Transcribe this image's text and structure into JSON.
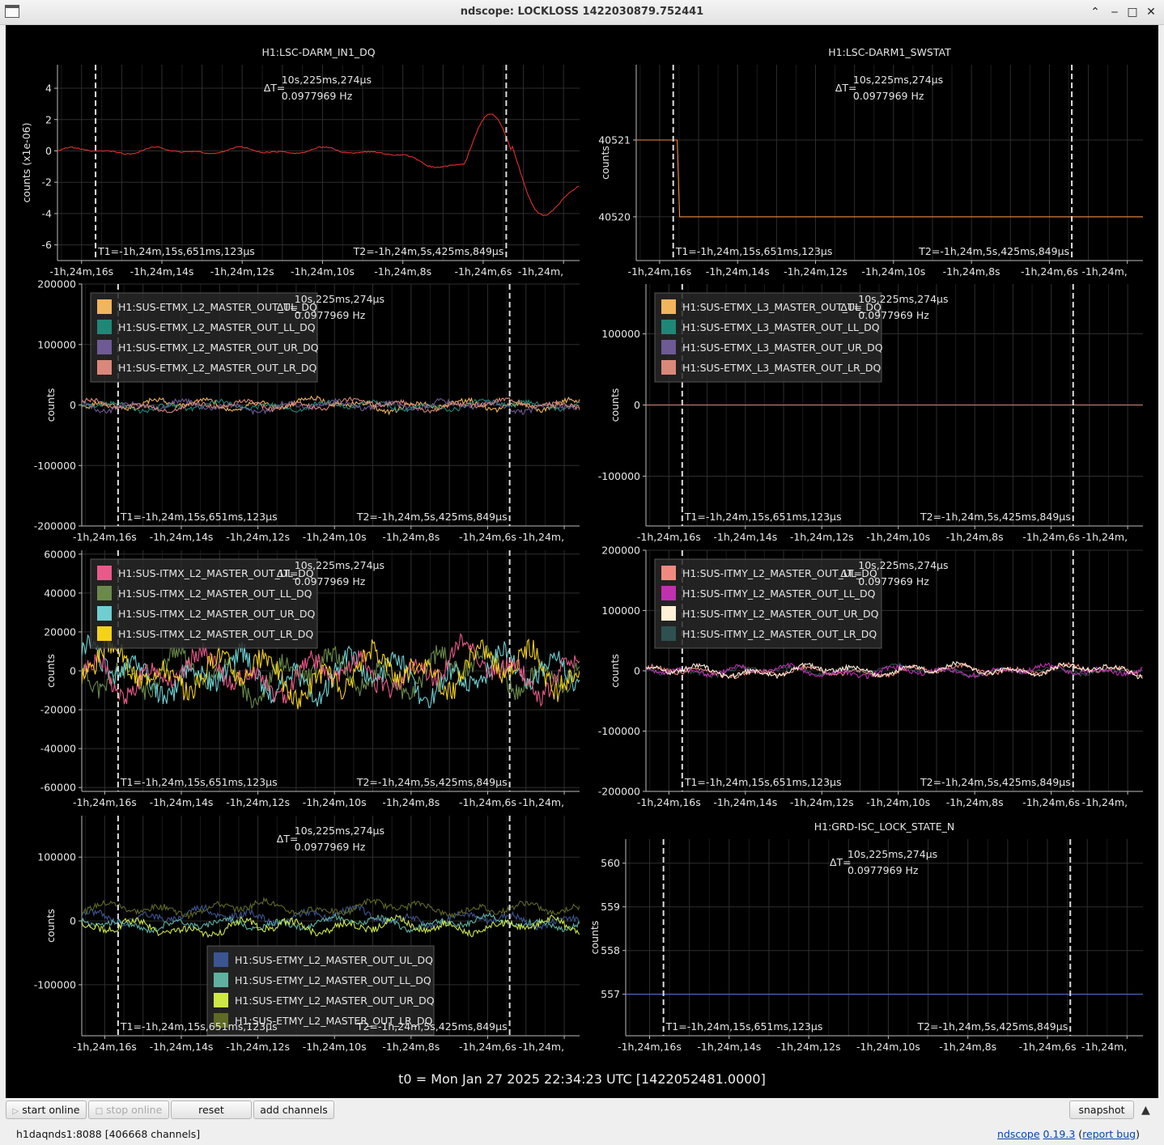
{
  "window": {
    "title": "ndscope: LOCKLOSS 1422030879.752441"
  },
  "cursor": {
    "delta_t": "10s,225ms,274µs",
    "freq": "0.0977969 Hz",
    "delta_label": "ΔT=",
    "t1": "T1=-1h,24m,15s,651ms,123µs",
    "t2": "T2=-1h,24m,5s,425ms,849µs"
  },
  "x_ticks": [
    "-1h,24m,16s",
    "-1h,24m,14s",
    "-1h,24m,12s",
    "-1h,24m,10s",
    "-1h,24m,8s",
    "-1h,24m,6s",
    "-1h,24m,"
  ],
  "x_tick_values": [
    -16,
    -14,
    -12,
    -10,
    -8,
    -6,
    -4
  ],
  "x_range": [
    -16.6,
    -3.6
  ],
  "cursor_x": [
    -15.651,
    -5.426
  ],
  "plots": [
    {
      "id": "p1",
      "title": "H1:LSC-DARM_IN1_DQ",
      "ylabel": "counts (x1e-06)",
      "yticks": [
        "4",
        "2",
        "0",
        "-2",
        "-4",
        "-6"
      ],
      "ytick_values": [
        4,
        2,
        0,
        -2,
        -4,
        -6
      ],
      "yrange": [
        -7,
        5.5
      ],
      "legend": [],
      "legend_pos": "none",
      "series": [
        {
          "color": "#e0302a",
          "type": "darm"
        }
      ]
    },
    {
      "id": "p2",
      "title": "H1:LSC-DARM1_SWSTAT",
      "ylabel": "counts",
      "yticks": [
        "40521",
        "40520"
      ],
      "ytick_values": [
        40521,
        40520
      ],
      "yrange": [
        40519.43,
        40521.98
      ],
      "legend": [],
      "legend_pos": "none",
      "series": [
        {
          "color": "#f08a40",
          "type": "step",
          "before": 40521,
          "after": 40520,
          "at": -15.55
        }
      ]
    },
    {
      "id": "p3",
      "title": "",
      "ylabel": "counts",
      "yticks": [
        "200000",
        "100000",
        "0",
        "-100000",
        "-200000"
      ],
      "ytick_values": [
        200000,
        100000,
        0,
        -100000,
        -200000
      ],
      "yrange": [
        -200000,
        200000
      ],
      "legend_pos": "top-left",
      "legend": [
        {
          "label": "H1:SUS-ETMX_L2_MASTER_OUT_UL_DQ",
          "color": "#f1b55e"
        },
        {
          "label": "H1:SUS-ETMX_L2_MASTER_OUT_LL_DQ",
          "color": "#1f8777"
        },
        {
          "label": "H1:SUS-ETMX_L2_MASTER_OUT_UR_DQ",
          "color": "#6e5a95"
        },
        {
          "label": "H1:SUS-ETMX_L2_MASTER_OUT_LR_DQ",
          "color": "#d9887a"
        }
      ],
      "series": [
        {
          "color": "#f1b55e",
          "type": "noise",
          "amp": 9000,
          "seed": 1
        },
        {
          "color": "#1f8777",
          "type": "noise",
          "amp": 8000,
          "seed": 2
        },
        {
          "color": "#6e5a95",
          "type": "noise",
          "amp": 9000,
          "seed": 3
        },
        {
          "color": "#d9887a",
          "type": "noise",
          "amp": 8000,
          "seed": 4
        }
      ]
    },
    {
      "id": "p4",
      "title": "",
      "ylabel": "counts",
      "yticks": [
        "100000",
        "0",
        "-100000"
      ],
      "ytick_values": [
        100000,
        0,
        -100000
      ],
      "yrange": [
        -170000,
        170000
      ],
      "legend_pos": "top-left",
      "legend": [
        {
          "label": "H1:SUS-ETMX_L3_MASTER_OUT_UL_DQ",
          "color": "#f1b55e"
        },
        {
          "label": "H1:SUS-ETMX_L3_MASTER_OUT_LL_DQ",
          "color": "#1f8777"
        },
        {
          "label": "H1:SUS-ETMX_L3_MASTER_OUT_UR_DQ",
          "color": "#6e5a95"
        },
        {
          "label": "H1:SUS-ETMX_L3_MASTER_OUT_LR_DQ",
          "color": "#d9887a"
        }
      ],
      "series": [
        {
          "color": "#d9887a",
          "type": "flat",
          "value": 0
        }
      ]
    },
    {
      "id": "p5",
      "title": "",
      "ylabel": "counts",
      "yticks": [
        "60000",
        "40000",
        "20000",
        "0",
        "-20000",
        "-40000",
        "-60000"
      ],
      "ytick_values": [
        60000,
        40000,
        20000,
        0,
        -20000,
        -40000,
        -60000
      ],
      "yrange": [
        -62000,
        62000
      ],
      "legend_pos": "top-left",
      "legend": [
        {
          "label": "H1:SUS-ITMX_L2_MASTER_OUT_UL_DQ",
          "color": "#e85a8a"
        },
        {
          "label": "H1:SUS-ITMX_L2_MASTER_OUT_LL_DQ",
          "color": "#6a8a4a"
        },
        {
          "label": "H1:SUS-ITMX_L2_MASTER_OUT_UR_DQ",
          "color": "#6ecfd0"
        },
        {
          "label": "H1:SUS-ITMX_L2_MASTER_OUT_LR_DQ",
          "color": "#f5d21a"
        }
      ],
      "series": [
        {
          "color": "#6a8a4a",
          "type": "noise",
          "amp": 11000,
          "seed": 11
        },
        {
          "color": "#6ecfd0",
          "type": "noise",
          "amp": 12000,
          "seed": 12
        },
        {
          "color": "#e85a8a",
          "type": "noise",
          "amp": 11000,
          "seed": 13
        },
        {
          "color": "#f5d21a",
          "type": "noise",
          "amp": 12000,
          "seed": 14
        }
      ]
    },
    {
      "id": "p6",
      "title": "",
      "ylabel": "counts",
      "yticks": [
        "200000",
        "100000",
        "0",
        "-100000",
        "-200000"
      ],
      "ytick_values": [
        200000,
        100000,
        0,
        -100000,
        -200000
      ],
      "yrange": [
        -200000,
        200000
      ],
      "legend_pos": "top-left",
      "legend": [
        {
          "label": "H1:SUS-ITMY_L2_MASTER_OUT_UL_DQ",
          "color": "#f08a80"
        },
        {
          "label": "H1:SUS-ITMY_L2_MASTER_OUT_LL_DQ",
          "color": "#c030b0"
        },
        {
          "label": "H1:SUS-ITMY_L2_MASTER_OUT_UR_DQ",
          "color": "#fff0d8"
        },
        {
          "label": "H1:SUS-ITMY_L2_MASTER_OUT_LR_DQ",
          "color": "#2f5050"
        }
      ],
      "series": [
        {
          "color": "#2f5050",
          "type": "noise",
          "amp": 7000,
          "seed": 21
        },
        {
          "color": "#f08a80",
          "type": "noise",
          "amp": 8000,
          "seed": 22
        },
        {
          "color": "#c030b0",
          "type": "noise",
          "amp": 9000,
          "seed": 23
        },
        {
          "color": "#fff0d8",
          "type": "noise",
          "amp": 9000,
          "seed": 24
        }
      ]
    },
    {
      "id": "p7",
      "title": "",
      "ylabel": "counts",
      "yticks": [
        "100000",
        "0",
        "-100000"
      ],
      "ytick_values": [
        100000,
        0,
        -100000
      ],
      "yrange": [
        -180000,
        165000
      ],
      "legend_pos": "bottom-center",
      "legend": [
        {
          "label": "H1:SUS-ETMY_L2_MASTER_OUT_UL_DQ",
          "color": "#3c5590"
        },
        {
          "label": "H1:SUS-ETMY_L2_MASTER_OUT_LL_DQ",
          "color": "#5fb0a0"
        },
        {
          "label": "H1:SUS-ETMY_L2_MASTER_OUT_UR_DQ",
          "color": "#cde845"
        },
        {
          "label": "H1:SUS-ETMY_L2_MASTER_OUT_LR_DQ",
          "color": "#5e6a25"
        }
      ],
      "series": [
        {
          "color": "#3c5590",
          "type": "noise",
          "amp": 12000,
          "seed": 31,
          "offset": 5000
        },
        {
          "color": "#5e6a25",
          "type": "noise",
          "amp": 10000,
          "seed": 32,
          "offset": 20000
        },
        {
          "color": "#5fb0a0",
          "type": "noise",
          "amp": 10000,
          "seed": 33,
          "offset": -5000
        },
        {
          "color": "#cde845",
          "type": "noise",
          "amp": 12000,
          "seed": 34,
          "offset": -10000
        }
      ]
    },
    {
      "id": "p8",
      "title": "H1:GRD-ISC_LOCK_STATE_N",
      "ylabel": "counts",
      "yticks": [
        "560",
        "559",
        "558",
        "557"
      ],
      "ytick_values": [
        560,
        559,
        558,
        557
      ],
      "yrange": [
        556.05,
        560.55
      ],
      "legend": [],
      "legend_pos": "none",
      "series": [
        {
          "color": "#4a70c8",
          "type": "flat",
          "value": 557
        }
      ]
    }
  ],
  "t0_label": "t0 = Mon Jan 27 2025 22:34:23 UTC [1422052481.0000]",
  "buttons": {
    "start_online": "start online",
    "stop_online": "stop online",
    "reset": "reset",
    "add_channels": "add channels",
    "snapshot": "snapshot"
  },
  "status": "h1daqnds1:8088  [406668 channels]",
  "version": {
    "name": "ndscope",
    "number": "0.19.3",
    "report": "report bug"
  }
}
